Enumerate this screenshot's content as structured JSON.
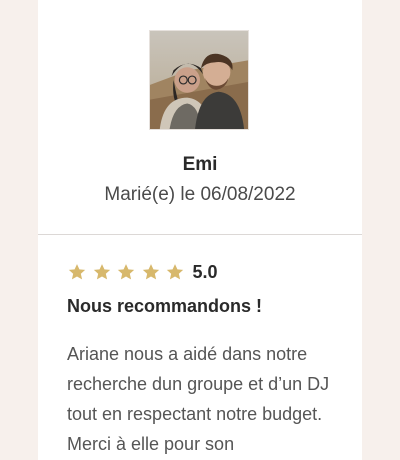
{
  "colors": {
    "page_background": "#f7f0ec",
    "card_background": "#ffffff",
    "star_color": "#d7b86c",
    "divider": "#dcd8d6"
  },
  "reviewer": {
    "avatar_icon": "reviewer-photo",
    "name": "Emi",
    "wedding_date": "Marié(e) le 06/08/2022"
  },
  "review": {
    "stars": 5,
    "rating": "5.0",
    "title": "Nous recommandons !",
    "text": "Ariane nous a aidé dans notre recherche dun groupe et d’un DJ tout en respectant notre budget. Merci à elle pour son"
  }
}
